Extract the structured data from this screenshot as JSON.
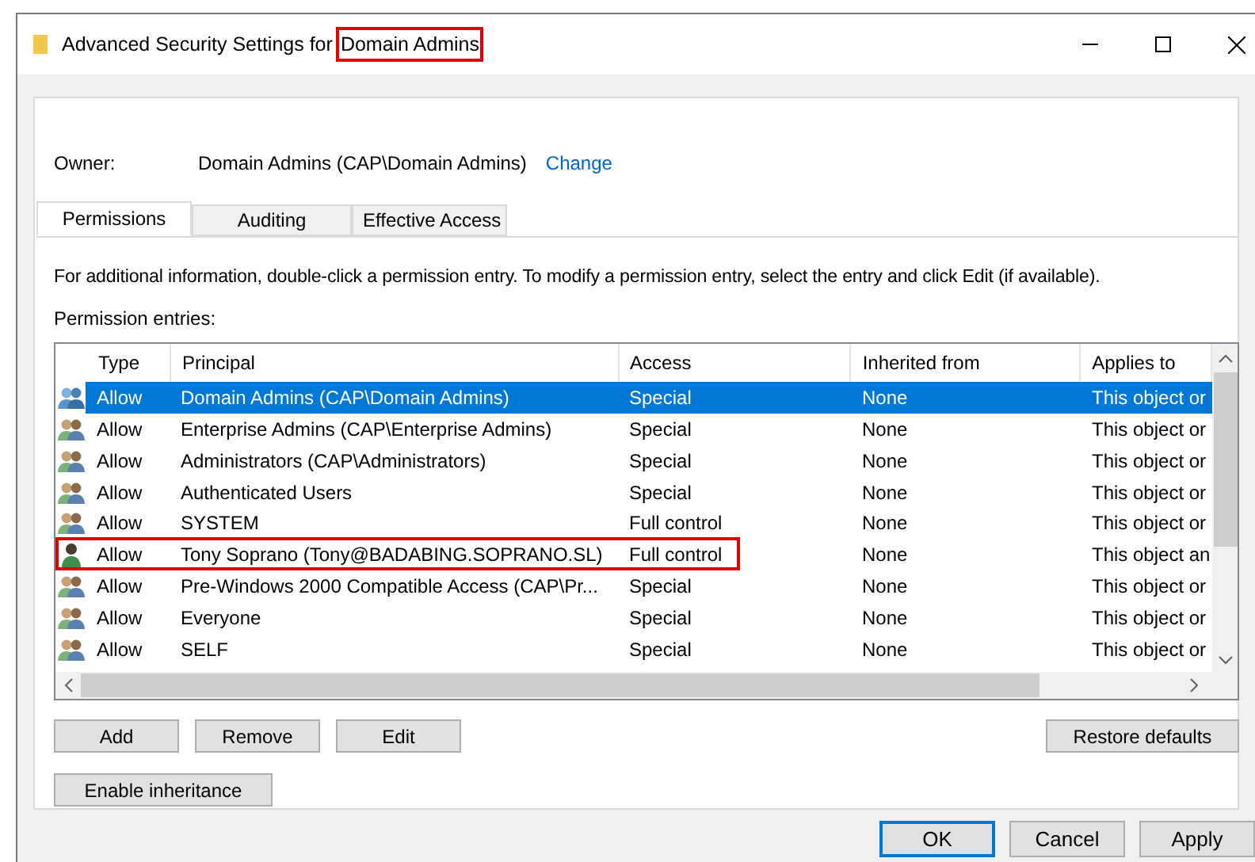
{
  "window": {
    "title_prefix": "Advanced Security Settings for",
    "title_highlight": "Domain Admins"
  },
  "owner": {
    "label": "Owner:",
    "value": "Domain Admins (CAP\\Domain Admins)",
    "link": "Change"
  },
  "tabs": [
    {
      "label": "Permissions",
      "selected": true
    },
    {
      "label": "Auditing",
      "selected": false
    },
    {
      "label": "Effective Access",
      "selected": false
    }
  ],
  "info": "For additional information, double-click a permission entry. To modify a permission entry, select the entry and click Edit (if available).",
  "entries_label": "Permission entries:",
  "table": {
    "columns": [
      "Type",
      "Principal",
      "Access",
      "Inherited from",
      "Applies to"
    ],
    "rows": [
      {
        "kind": "group",
        "type": "Allow",
        "principal": "Domain Admins (CAP\\Domain Admins)",
        "access": "Special",
        "inherited": "None",
        "applies": "This object or",
        "selected": true,
        "highlighted": false
      },
      {
        "kind": "group",
        "type": "Allow",
        "principal": "Enterprise Admins (CAP\\Enterprise Admins)",
        "access": "Special",
        "inherited": "None",
        "applies": "This object or",
        "selected": false,
        "highlighted": false
      },
      {
        "kind": "group",
        "type": "Allow",
        "principal": "Administrators (CAP\\Administrators)",
        "access": "Special",
        "inherited": "None",
        "applies": "This object or",
        "selected": false,
        "highlighted": false
      },
      {
        "kind": "group",
        "type": "Allow",
        "principal": "Authenticated Users",
        "access": "Special",
        "inherited": "None",
        "applies": "This object or",
        "selected": false,
        "highlighted": false
      },
      {
        "kind": "group",
        "type": "Allow",
        "principal": "SYSTEM",
        "access": "Full control",
        "inherited": "None",
        "applies": "This object or",
        "selected": false,
        "highlighted": false
      },
      {
        "kind": "user",
        "type": "Allow",
        "principal": "Tony Soprano (Tony@BADABING.SOPRANO.SL)",
        "access": "Full control",
        "inherited": "None",
        "applies": "This object an",
        "selected": false,
        "highlighted": true
      },
      {
        "kind": "group",
        "type": "Allow",
        "principal": "Pre-Windows 2000 Compatible Access (CAP\\Pr...",
        "access": "Special",
        "inherited": "None",
        "applies": "This object or",
        "selected": false,
        "highlighted": false
      },
      {
        "kind": "group",
        "type": "Allow",
        "principal": "Everyone",
        "access": "Special",
        "inherited": "None",
        "applies": "This object or",
        "selected": false,
        "highlighted": false
      },
      {
        "kind": "group",
        "type": "Allow",
        "principal": "SELF",
        "access": "Special",
        "inherited": "None",
        "applies": "This object or",
        "selected": false,
        "highlighted": false
      }
    ]
  },
  "entry_buttons": [
    "Add",
    "Remove",
    "Edit"
  ],
  "restore_button": "Restore defaults",
  "inheritance_button": "Enable inheritance",
  "dialog_buttons": [
    {
      "label": "OK",
      "default": true
    },
    {
      "label": "Cancel",
      "default": false
    },
    {
      "label": "Apply",
      "default": false
    }
  ]
}
